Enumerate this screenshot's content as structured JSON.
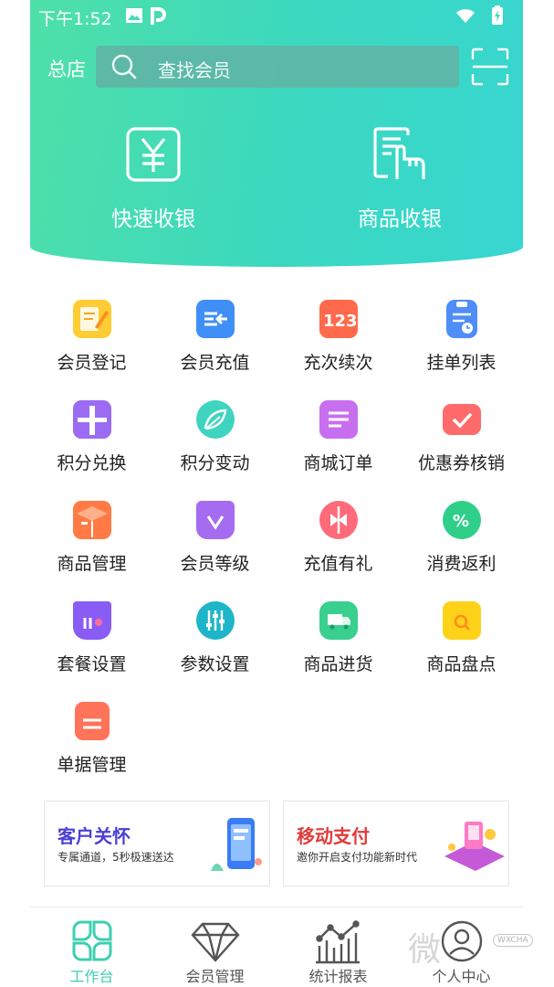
{
  "status": {
    "time": "下午1:52"
  },
  "header": {
    "store": "总店",
    "search_placeholder": "查找会员"
  },
  "quick_actions": [
    {
      "label": "快速收银"
    },
    {
      "label": "商品收银"
    }
  ],
  "grid": [
    {
      "label": "会员登记",
      "icon": "register-icon",
      "color": "#ffcc33"
    },
    {
      "label": "会员充值",
      "icon": "recharge-icon",
      "color": "#3f8ff6"
    },
    {
      "label": "充次续次",
      "icon": "count-123-icon",
      "color": "#ff6a4d"
    },
    {
      "label": "挂单列表",
      "icon": "clipboard-icon",
      "color": "#4f8df7"
    },
    {
      "label": "积分兑换",
      "icon": "gift-icon",
      "color": "#9b6bf2"
    },
    {
      "label": "积分变动",
      "icon": "feather-icon",
      "color": "#3fd4c0"
    },
    {
      "label": "商城订单",
      "icon": "order-icon",
      "color": "#c86ff0"
    },
    {
      "label": "优惠券核销",
      "icon": "coupon-icon",
      "color": "#ff6b6b"
    },
    {
      "label": "商品管理",
      "icon": "box-icon",
      "color": "#ff7a45"
    },
    {
      "label": "会员等级",
      "icon": "crown-icon",
      "color": "#a56bf0"
    },
    {
      "label": "充值有礼",
      "icon": "ribbon-icon",
      "color": "#ff6b7a"
    },
    {
      "label": "消费返利",
      "icon": "percent-badge-icon",
      "color": "#2fcf8a"
    },
    {
      "label": "套餐设置",
      "icon": "basket-icon",
      "color": "#8a5cf6"
    },
    {
      "label": "参数设置",
      "icon": "sliders-icon",
      "color": "#1fb5c9"
    },
    {
      "label": "商品进货",
      "icon": "truck-icon",
      "color": "#39cf8f"
    },
    {
      "label": "商品盘点",
      "icon": "inventory-search-icon",
      "color": "#ffd21a"
    },
    {
      "label": "单据管理",
      "icon": "folder-icon",
      "color": "#ff7358"
    }
  ],
  "banners": [
    {
      "title": "客户关怀",
      "subtitle": "专属通道，5秒极速送达",
      "color": "#4a3fd6"
    },
    {
      "title": "移动支付",
      "subtitle": "邀你开启支付功能新时代",
      "color": "#e23a3a"
    }
  ],
  "tabs": [
    {
      "label": "工作台",
      "icon": "workbench-icon",
      "active": true
    },
    {
      "label": "会员管理",
      "icon": "diamond-icon",
      "active": false
    },
    {
      "label": "统计报表",
      "icon": "chart-icon",
      "active": false
    },
    {
      "label": "个人中心",
      "icon": "profile-icon",
      "active": false
    }
  ],
  "watermark": {
    "text": "微",
    "badge": "WXCHA"
  }
}
